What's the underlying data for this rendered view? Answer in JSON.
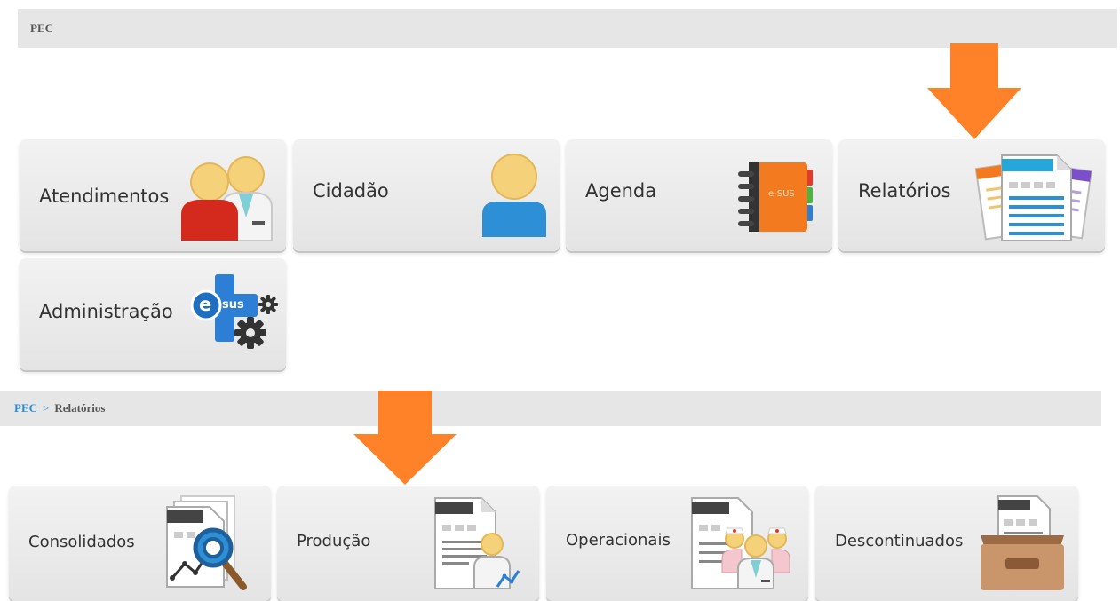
{
  "header": {
    "title": "PEC"
  },
  "main_tiles": [
    {
      "label": "Atendimentos",
      "icon": "professionals-icon"
    },
    {
      "label": "Cidadão",
      "icon": "citizen-icon"
    },
    {
      "label": "Agenda",
      "icon": "agenda-book-icon"
    },
    {
      "label": "Relatórios",
      "icon": "reports-icon"
    },
    {
      "label": "Administração",
      "icon": "esus-admin-icon"
    }
  ],
  "icon_text": {
    "agenda_brand": "e-SUS",
    "esus_e": "e",
    "esus_sus": "sus"
  },
  "breadcrumb": {
    "root": "PEC",
    "separator": ">",
    "current": "Relatórios"
  },
  "report_tiles": [
    {
      "label": "Consolidados",
      "icon": "consolidated-report-icon"
    },
    {
      "label": "Produção",
      "icon": "production-report-icon"
    },
    {
      "label": "Operacionais",
      "icon": "operational-report-icon"
    },
    {
      "label": "Descontinuados",
      "icon": "archive-box-icon"
    }
  ],
  "colors": {
    "arrow": "#ff8128",
    "breadcrumb_link": "#2a8ad6",
    "bar": "#e6e6e6"
  }
}
